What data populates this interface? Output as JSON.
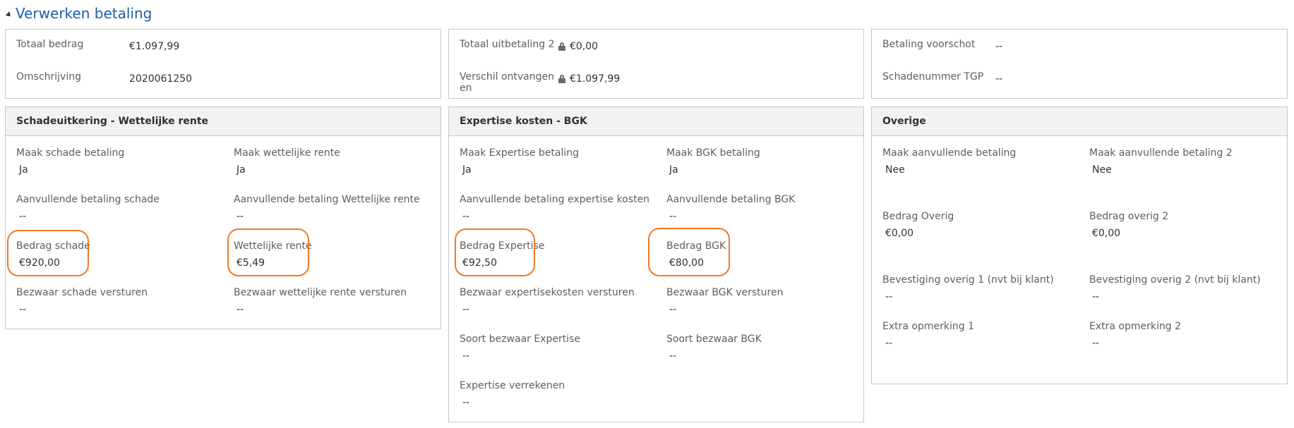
{
  "section": {
    "title": "Verwerken betaling"
  },
  "top": {
    "card1": [
      {
        "label": "Totaal bedrag",
        "value": "€1.097,99"
      },
      {
        "label": "Omschrijving",
        "value": "2020061250"
      }
    ],
    "card2": [
      {
        "label": "Totaal uitbetaling 2",
        "value": "€0,00",
        "locked": true
      },
      {
        "label": "Verschil ontvangen en",
        "value": "€1.097,99",
        "locked": true
      }
    ],
    "card3": [
      {
        "label": "Betaling voorschot",
        "value": "--"
      },
      {
        "label": "Schadenummer TGP",
        "value": "--"
      }
    ]
  },
  "schade": {
    "header": "Schadeuitkering - Wettelijke rente",
    "fields": [
      {
        "label": "Maak schade betaling",
        "value": "Ja"
      },
      {
        "label": "Maak wettelijke rente",
        "value": "Ja"
      },
      {
        "label": "Aanvullende betaling schade",
        "value": "--"
      },
      {
        "label": "Aanvullende betaling Wettelijke rente",
        "value": "--"
      },
      {
        "label": "Bedrag schade",
        "value": "€920,00"
      },
      {
        "label": "Wettelijke rente",
        "value": "€5,49"
      },
      {
        "label": "Bezwaar schade versturen",
        "value": "--"
      },
      {
        "label": "Bezwaar wettelijke rente versturen",
        "value": "--"
      }
    ]
  },
  "expertise": {
    "header": "Expertise kosten - BGK",
    "fields": [
      {
        "label": "Maak Expertise betaling",
        "value": "Ja"
      },
      {
        "label": "Maak BGK betaling",
        "value": "Ja"
      },
      {
        "label": "Aanvullende betaling expertise kosten",
        "value": "--"
      },
      {
        "label": "Aanvullende betaling BGK",
        "value": "--"
      },
      {
        "label": "Bedrag Expertise",
        "value": "€92,50"
      },
      {
        "label": "Bedrag BGK",
        "value": "€80,00"
      },
      {
        "label": "Bezwaar expertisekosten versturen",
        "value": "--"
      },
      {
        "label": "Bezwaar BGK versturen",
        "value": "--"
      },
      {
        "label": "Soort bezwaar Expertise",
        "value": "--"
      },
      {
        "label": "Soort bezwaar BGK",
        "value": "--"
      },
      {
        "label": "Expertise verrekenen",
        "value": "--"
      }
    ]
  },
  "overige": {
    "header": "Overige",
    "fields": [
      {
        "label": "Maak aanvullende betaling",
        "value": "Nee"
      },
      {
        "label": "Maak aanvullende betaling 2",
        "value": "Nee"
      },
      {
        "label": "Bedrag Overig",
        "value": "€0,00"
      },
      {
        "label": "Bedrag overig 2",
        "value": "€0,00"
      },
      {
        "label": "Bevestiging overig 1 (nvt bij klant)",
        "value": "--"
      },
      {
        "label": "Bevestiging overig 2 (nvt bij klant)",
        "value": "--"
      },
      {
        "label": "Extra opmerking 1",
        "value": "--"
      },
      {
        "label": "Extra opmerking 2",
        "value": "--"
      }
    ]
  },
  "colors": {
    "accent": "#1b5fad",
    "highlight": "#f07a28",
    "border": "#c8c6c4",
    "header_bg": "#f3f2f1"
  },
  "icons": {
    "collapse": "triangle-down-icon",
    "lock": "lock-icon"
  }
}
